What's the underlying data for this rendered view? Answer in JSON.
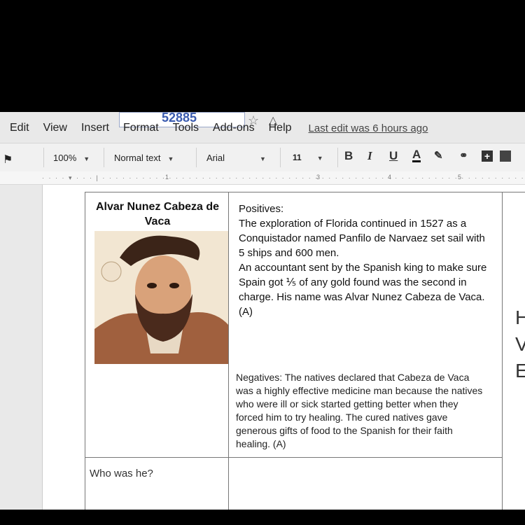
{
  "title": {
    "doc_title": "52885"
  },
  "menu": {
    "edit": "Edit",
    "view": "View",
    "insert": "Insert",
    "format": "Format",
    "tools": "Tools",
    "addons": "Add-ons",
    "help": "Help",
    "last_edit": "Last edit was 6 hours ago"
  },
  "toolbar": {
    "zoom": "100%",
    "style": "Normal text",
    "font": "Arial",
    "size": "11",
    "bold": "B",
    "italic": "I",
    "underline": "U",
    "color": "A"
  },
  "ruler": {
    "n1": "1",
    "n3": "3",
    "n4": "4",
    "n5": "5"
  },
  "table": {
    "name": "Alvar Nunez Cabeza de Vaca",
    "positives_head": "Positives:",
    "positives_p1": "The exploration of Florida continued in 1527 as a Conquistador named Panfilo de Narvaez set sail with 5 ships and 600 men.",
    "positives_p2": "An accountant sent by the Spanish king to make sure Spain got ⅕ of any gold found was the second in charge.  His name was Alvar Nunez Cabeza de Vaca. (A)",
    "negatives": "Negatives: The natives declared that Cabeza de Vaca was a highly effective medicine man because the natives who were ill or sick started getting better when they forced him to try healing. The cured natives gave generous gifts of food to the Spanish for their faith healing. (A)",
    "who": "Who was he?"
  },
  "side_letters": [
    "H",
    "V",
    "E"
  ]
}
